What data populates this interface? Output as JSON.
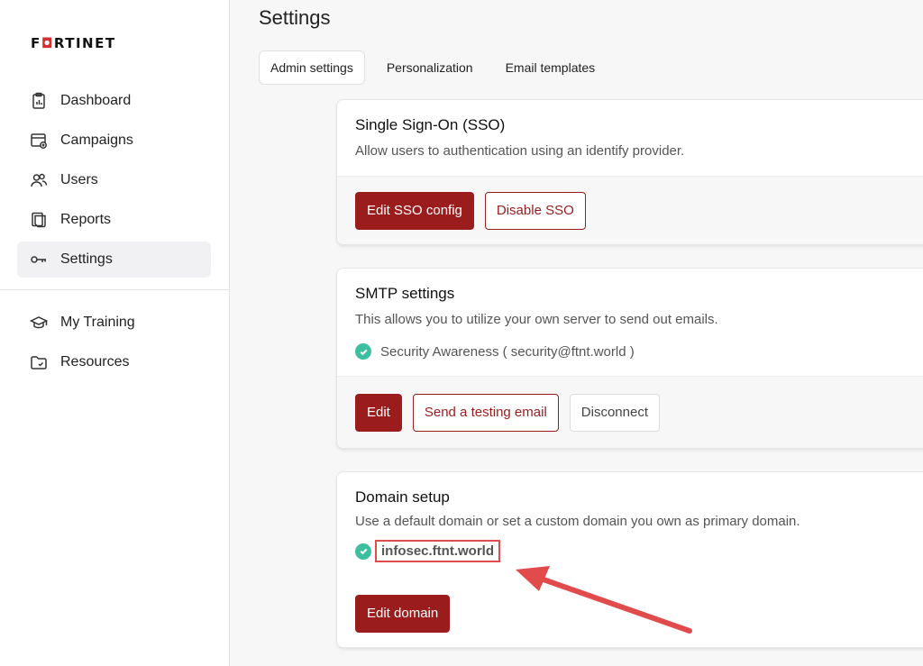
{
  "sidebar": {
    "logo": "F RTINET",
    "nav": [
      {
        "label": "Dashboard",
        "icon": "clipboard-chart-icon"
      },
      {
        "label": "Campaigns",
        "icon": "browser-plus-icon"
      },
      {
        "label": "Users",
        "icon": "users-icon"
      },
      {
        "label": "Reports",
        "icon": "report-icon"
      },
      {
        "label": "Settings",
        "icon": "key-icon",
        "active": true
      }
    ],
    "nav_secondary": [
      {
        "label": "My Training",
        "icon": "graduation-cap-icon"
      },
      {
        "label": "Resources",
        "icon": "folder-check-icon"
      }
    ]
  },
  "page": {
    "title": "Settings",
    "tabs": [
      {
        "label": "Admin settings",
        "active": true
      },
      {
        "label": "Personalization"
      },
      {
        "label": "Email templates"
      }
    ]
  },
  "sso": {
    "title": "Single Sign-On (SSO)",
    "description": "Allow users to authentication using an identify provider.",
    "edit_label": "Edit SSO config",
    "disable_label": "Disable SSO"
  },
  "smtp": {
    "title": "SMTP settings",
    "description": "This allows you to utilize your own server to send out emails.",
    "status": "Security Awareness ( security@ftnt.world )",
    "edit_label": "Edit",
    "test_label": "Send a testing email",
    "disconnect_label": "Disconnect"
  },
  "domain": {
    "title": "Domain setup",
    "description": "Use a default domain or set a custom domain you own as primary domain.",
    "value": "infosec.ftnt.world",
    "edit_label": "Edit domain"
  },
  "colors": {
    "accent": "#9b1c1c",
    "success": "#3bbf9f",
    "highlight": "#e24b4b"
  }
}
